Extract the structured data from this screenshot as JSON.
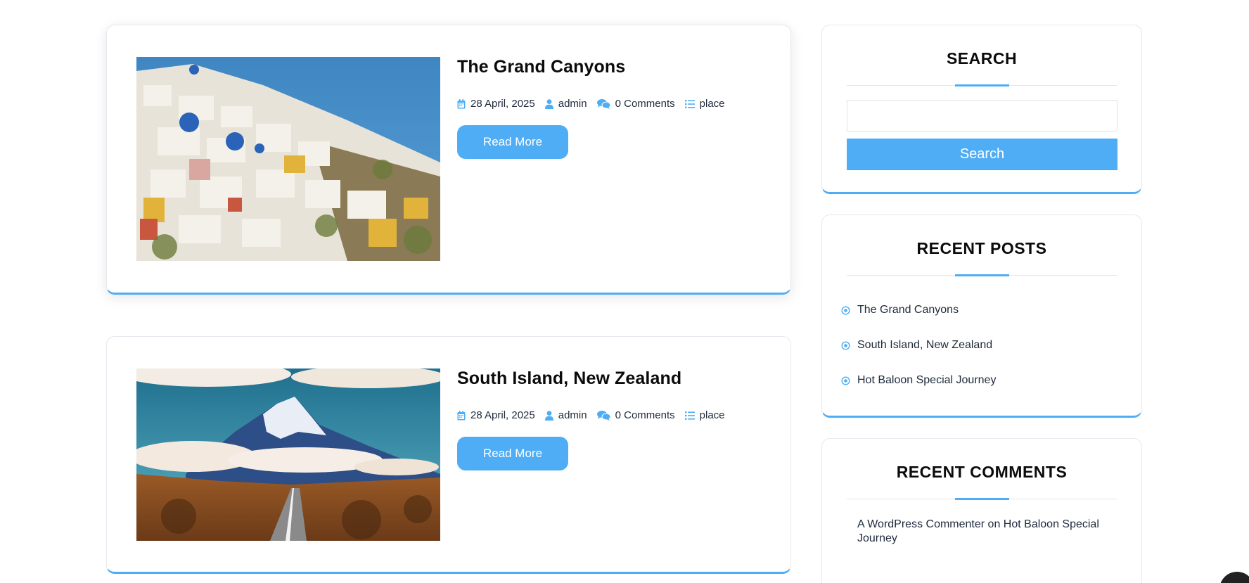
{
  "colors": {
    "accent": "#4eadf5",
    "text": "#1e2a3b",
    "heading": "#0b0b0b"
  },
  "posts": [
    {
      "title": "The Grand Canyons",
      "date": "28 April, 2025",
      "author": "admin",
      "comments": "0 Comments",
      "category": "place",
      "read_more": "Read More"
    },
    {
      "title": "South Island, New Zealand",
      "date": "28 April, 2025",
      "author": "admin",
      "comments": "0 Comments",
      "category": "place",
      "read_more": "Read More"
    }
  ],
  "sidebar": {
    "search": {
      "title": "SEARCH",
      "input_value": "",
      "button_label": "Search"
    },
    "recent_posts": {
      "title": "RECENT POSTS",
      "items": [
        "The Grand Canyons",
        "South Island, New Zealand",
        "Hot Baloon Special Journey"
      ]
    },
    "recent_comments": {
      "title": "RECENT COMMENTS",
      "author": "A WordPress Commenter",
      "on": "on",
      "post": "Hot Baloon Special Journey"
    }
  },
  "icons": {
    "date": "calendar-icon",
    "author": "user-icon",
    "comments": "comments-icon",
    "category": "list-icon",
    "list_bullet": "dot-circle-icon"
  }
}
